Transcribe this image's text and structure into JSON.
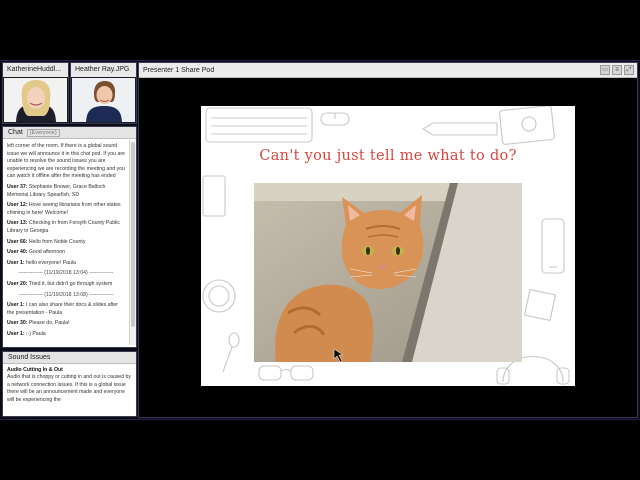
{
  "cameras": [
    {
      "name": "KatherineHuddl..."
    },
    {
      "name": "Heather Ray.JPG"
    }
  ],
  "chat": {
    "title": "Chat",
    "audience": "(Everyone)",
    "intro": "left corner of the room. If there is a global sound issue we will announce it in this chat pod. If you are unable to resolve the sound issues you are experiencing we are recording the meeting and you can watch it offline after the meeting has ended",
    "messages": [
      {
        "user": "User 37:",
        "text": " Stephanie Brewer, Grace Balloch Memorial Library Spearfish, SD"
      },
      {
        "user": "User 12:",
        "text": " Hove seeing librarians from other states chiming in here!  Welcome!"
      },
      {
        "user": "User 13:",
        "text": " Checking in from Forsyth County Public Library in Georgia"
      },
      {
        "user": "User 66:",
        "text": " Hello from Noble County"
      },
      {
        "user": "User 40:",
        "text": " Good afternoon"
      },
      {
        "user": "User 1:",
        "text": " hello everyone!  Paula"
      },
      {
        "separator": "-------------- (11/19/2018 13:04) --------------"
      },
      {
        "user": "User 20:",
        "text": " Tried it, but didn't go through system"
      },
      {
        "separator": "-------------- (11/19/2018 13:08) --------------"
      },
      {
        "user": "User 1:",
        "text": " I can also share their docs & slides after the presentation - Paula"
      },
      {
        "user": "User 30:",
        "text": " Please do, Paula!"
      },
      {
        "user": "User 1:",
        "text": " :-) Paula"
      }
    ]
  },
  "sound": {
    "title": "Sound Issues",
    "item_title": "Audio Cutting In & Out",
    "item_text": "Audio that is choppy or cutting in and out is caused by a network connection issues. If this is a global issue there will be an announcement made and everyone will be experiencing the"
  },
  "share": {
    "title": "Presenter 1 Share Pod",
    "slide_title": "Can't you just tell me what to do?"
  },
  "colors": {
    "slide_title": "#d6463f",
    "pod_border": "#3a3a55"
  }
}
